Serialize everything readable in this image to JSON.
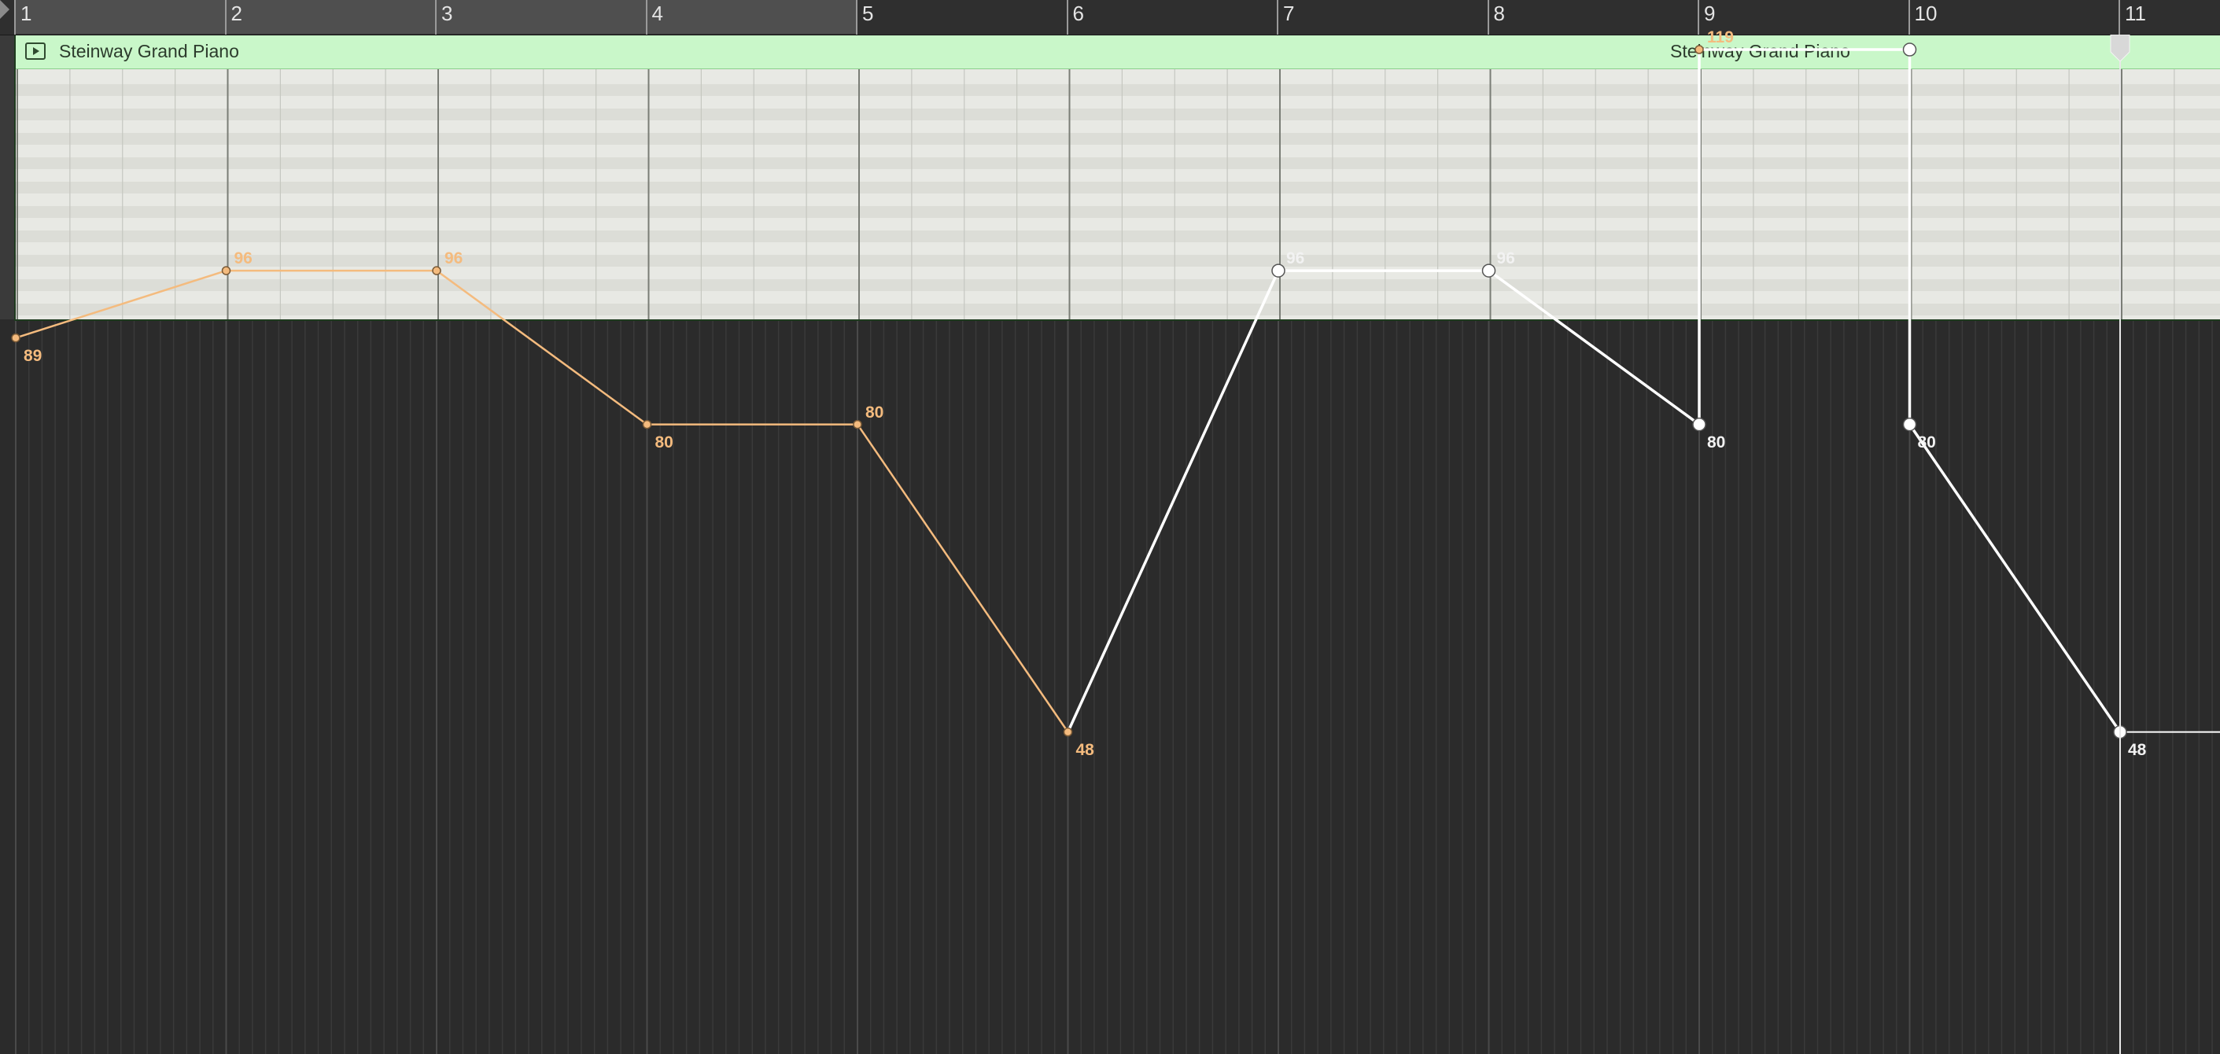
{
  "ruler": {
    "bars": [
      "1",
      "2",
      "3",
      "4",
      "5",
      "6",
      "7",
      "8",
      "9",
      "10",
      "11"
    ]
  },
  "region": {
    "name_primary": "Steinway Grand Piano",
    "name_secondary": "Steinway Grand Piano",
    "color": "#c9f7c9"
  },
  "automation": {
    "selected_color": "#f4bb7e",
    "unselected_color": "#ffffff",
    "points": [
      {
        "bar": 1.0,
        "value": 89,
        "label": "89",
        "selected": true
      },
      {
        "bar": 2.0,
        "value": 96,
        "label": "96",
        "selected": true
      },
      {
        "bar": 3.0,
        "value": 96,
        "label": "96",
        "selected": true
      },
      {
        "bar": 4.0,
        "value": 80,
        "label": "80",
        "selected": true
      },
      {
        "bar": 5.0,
        "value": 80,
        "label": "80",
        "selected": true
      },
      {
        "bar": 6.0,
        "value": 48,
        "label": "48",
        "selected": true
      },
      {
        "bar": 7.0,
        "value": 96,
        "label": "96",
        "selected": false
      },
      {
        "bar": 8.0,
        "value": 96,
        "label": "96",
        "selected": false
      },
      {
        "bar": 9.0,
        "value": 80,
        "label": "80",
        "selected": false
      },
      {
        "bar": 9.0,
        "value": 119,
        "label": "119",
        "selected": true
      },
      {
        "bar": 10.0,
        "value": 119,
        "label": "",
        "selected": false
      },
      {
        "bar": 10.0,
        "value": 80,
        "label": "80",
        "selected": false
      },
      {
        "bar": 11.0,
        "value": 48,
        "label": "48",
        "selected": false
      }
    ]
  },
  "playhead": {
    "bar": 11.0
  }
}
